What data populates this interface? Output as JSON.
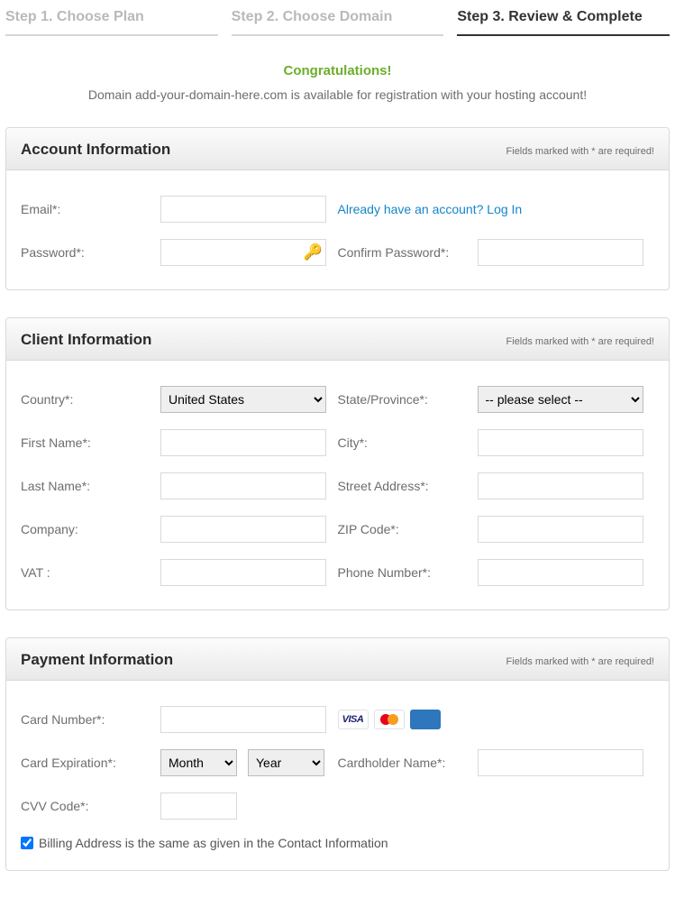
{
  "steps": {
    "s1": "Step 1. Choose Plan",
    "s2": "Step 2. Choose Domain",
    "s3": "Step 3. Review & Complete"
  },
  "intro": {
    "title": "Congratulations!",
    "sub": "Domain add-your-domain-here.com is available for registration with your hosting account!"
  },
  "common": {
    "required_note": "Fields marked with * are required!"
  },
  "account": {
    "title": "Account Information",
    "email_lbl": "Email*:",
    "password_lbl": "Password*:",
    "confirm_lbl": "Confirm Password*:",
    "login_link": "Already have an account? Log In"
  },
  "client": {
    "title": "Client Information",
    "country_lbl": "Country*:",
    "country_val": "United States",
    "state_lbl": "State/Province*:",
    "state_val": "-- please select --",
    "first_lbl": "First Name*:",
    "city_lbl": "City*:",
    "last_lbl": "Last Name*:",
    "street_lbl": "Street Address*:",
    "company_lbl": "Company:",
    "zip_lbl": "ZIP Code*:",
    "vat_lbl": "VAT :",
    "phone_lbl": "Phone Number*:"
  },
  "payment": {
    "title": "Payment Information",
    "card_num_lbl": "Card Number*:",
    "exp_lbl": "Card Expiration*:",
    "month_val": "Month",
    "year_val": "Year",
    "holder_lbl": "Cardholder Name*:",
    "cvv_lbl": "CVV Code*:",
    "billing_same": "Billing Address is the same as given in the Contact Information",
    "visa": "VISA",
    "amex": ""
  }
}
